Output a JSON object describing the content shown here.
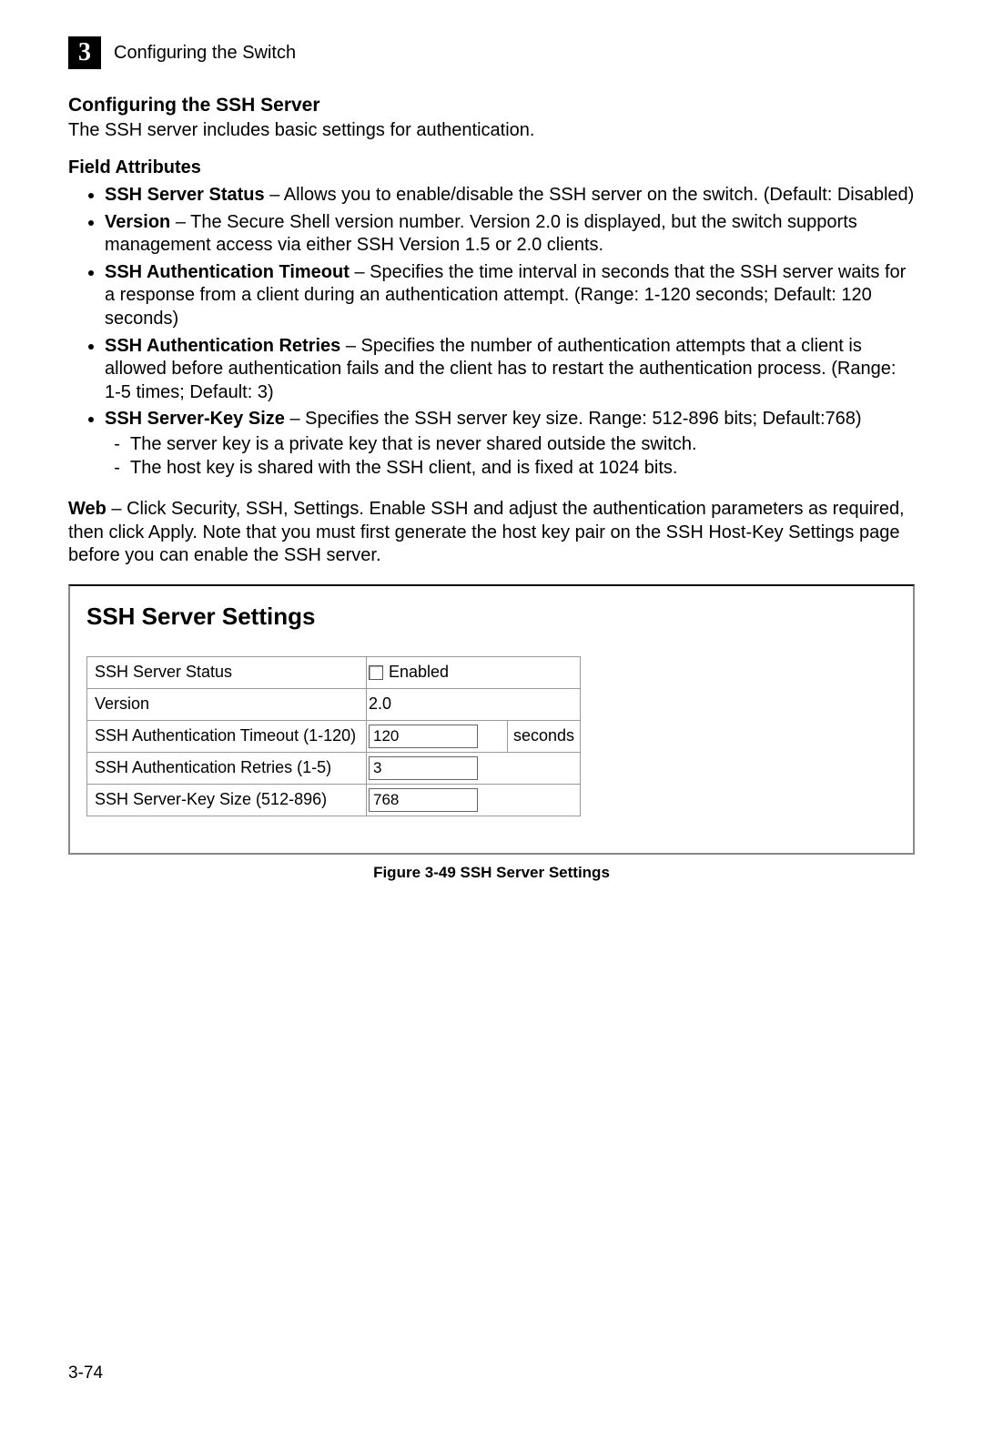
{
  "header": {
    "chapter_number": "3",
    "chapter_title": "Configuring the Switch"
  },
  "section": {
    "heading": "Configuring the SSH Server",
    "intro": "The SSH server includes basic settings for authentication."
  },
  "field_attributes": {
    "heading": "Field Attributes",
    "items": [
      {
        "term": "SSH Server Status",
        "desc": " – Allows you to enable/disable the SSH server on the switch. (Default: Disabled)"
      },
      {
        "term": "Version",
        "desc": " – The Secure Shell version number. Version 2.0 is displayed, but the switch supports management access via either SSH Version 1.5 or 2.0 clients."
      },
      {
        "term": "SSH Authentication Timeout",
        "desc": " – Specifies the time interval in seconds that the SSH server waits for a response from a client during an authentication attempt. (Range: 1-120 seconds; Default: 120 seconds)"
      },
      {
        "term": "SSH Authentication Retries",
        "desc": " – Specifies the number of authentication attempts that a client is allowed before authentication fails and the client has to restart the authentication process. (Range: 1-5 times; Default: 3)"
      },
      {
        "term": "SSH Server-Key Size",
        "desc": " – Specifies the SSH server key size. Range: 512-896 bits; Default:768)",
        "sub": [
          "The server key is a private key that is never shared outside the switch.",
          "The host key is shared with the SSH client, and is fixed at 1024 bits."
        ]
      }
    ]
  },
  "web_note": {
    "term": "Web",
    "desc": " – Click Security, SSH, Settings. Enable SSH and adjust the authentication parameters as required, then click Apply. Note that you must first generate the host key pair on the SSH Host-Key Settings page before you can enable the SSH server."
  },
  "figure": {
    "panel_title": "SSH Server Settings",
    "rows": {
      "status_label": "SSH Server Status",
      "status_value_label": "Enabled",
      "status_checked": false,
      "version_label": "Version",
      "version_value": "2.0",
      "timeout_label": "SSH Authentication Timeout (1-120)",
      "timeout_value": "120",
      "timeout_unit": "seconds",
      "retries_label": "SSH Authentication Retries (1-5)",
      "retries_value": "3",
      "keysize_label": "SSH Server-Key Size (512-896)",
      "keysize_value": "768"
    },
    "caption": "Figure 3-49  SSH Server Settings"
  },
  "page_number": "3-74"
}
